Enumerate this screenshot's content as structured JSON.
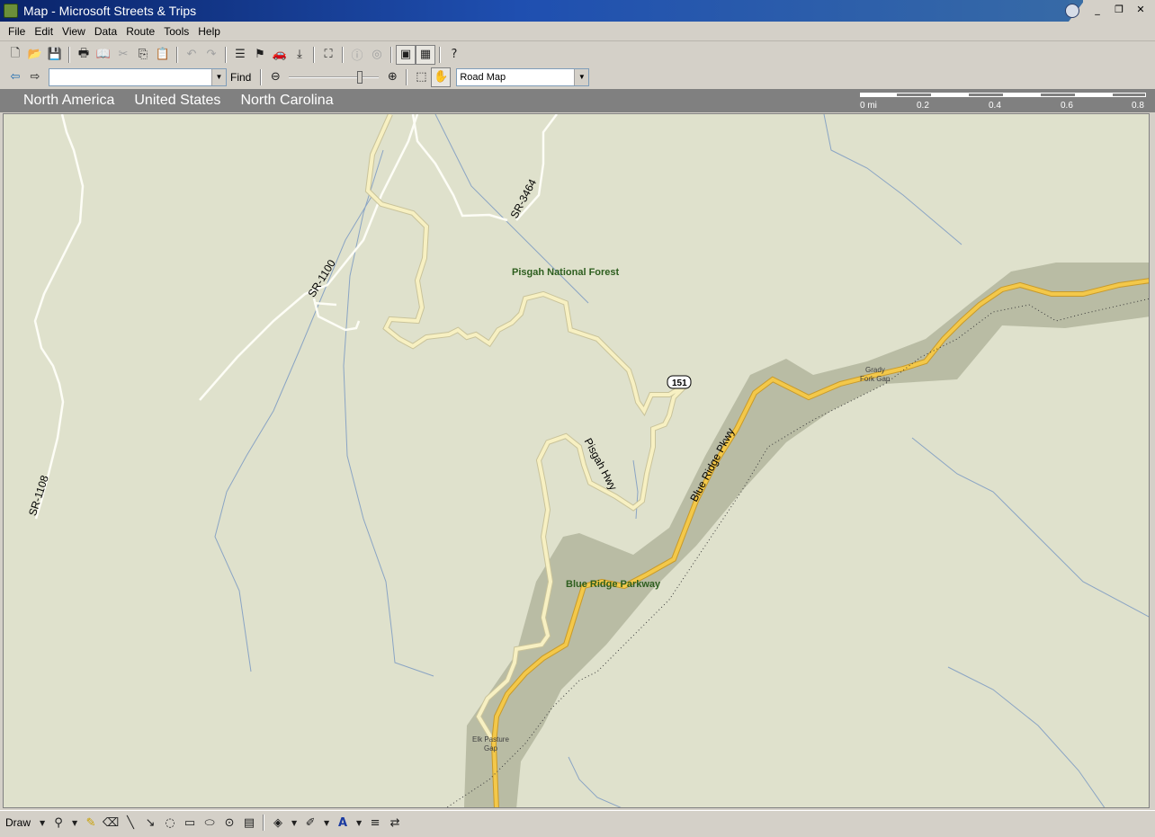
{
  "window": {
    "title": "Map - Microsoft Streets & Trips",
    "minimize_glyph": "_",
    "restore_glyph": "❐",
    "close_glyph": "✕"
  },
  "menu": {
    "items": [
      "File",
      "Edit",
      "View",
      "Data",
      "Route",
      "Tools",
      "Help"
    ]
  },
  "toolbar": {
    "find_value": "",
    "find_label": "Find",
    "map_style": "Road Map"
  },
  "location": {
    "crumbs": [
      "North America",
      "United States",
      "North Carolina"
    ]
  },
  "scale": {
    "labels": [
      "0 mi",
      "0.2",
      "0.4",
      "0.6",
      "0.8"
    ]
  },
  "map": {
    "labels": {
      "sr3464": "SR-3464",
      "sr1100": "SR-1100",
      "sr1108": "SR-1108",
      "forest": "Pisgah National Forest",
      "shield151": "151",
      "pisgah_hwy": "Pisgah Hwy",
      "brp_road": "Blue Ridge Pkwy",
      "brp_park": "Blue Ridge Parkway",
      "grady1": "Grady",
      "grady2": "Fork Gap",
      "elk1": "Elk Pasture",
      "elk2": "Gap"
    },
    "colors": {
      "land": "#dfe1cc",
      "park": "#b9bca4",
      "parkway": "#f3c84a",
      "highway": "#f7f0c2",
      "stream": "#8aa4c4",
      "label_green": "#2d5e1e"
    }
  },
  "draw": {
    "label": "Draw"
  }
}
